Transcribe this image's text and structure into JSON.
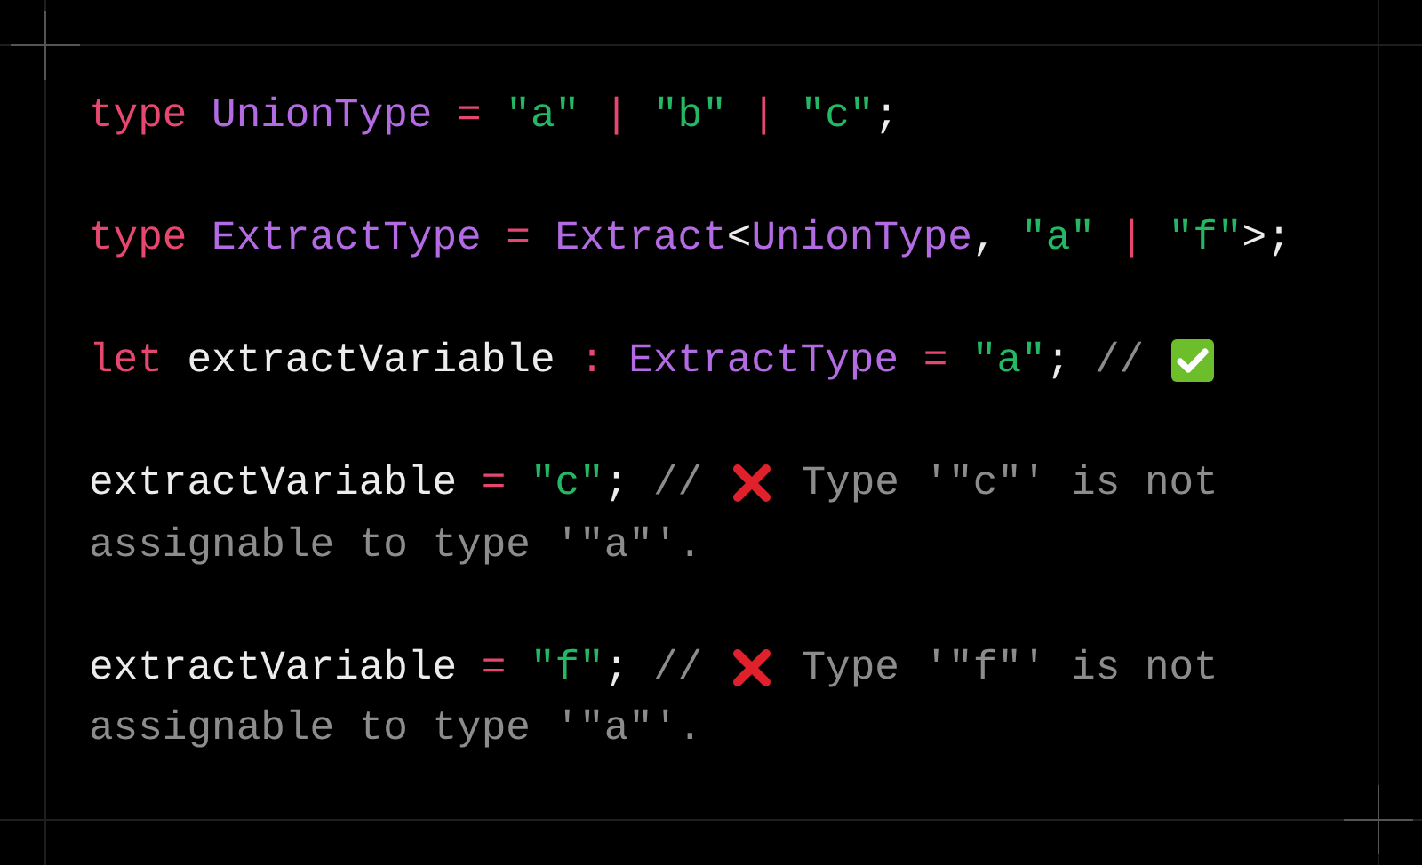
{
  "statements": [
    {
      "lines": [
        [
          {
            "kind": "keyword",
            "text": "type "
          },
          {
            "kind": "type",
            "text": "UnionType "
          },
          {
            "kind": "operator",
            "text": "= "
          },
          {
            "kind": "string",
            "text": "\"a\" "
          },
          {
            "kind": "operator",
            "text": "| "
          },
          {
            "kind": "string",
            "text": "\"b\" "
          },
          {
            "kind": "operator",
            "text": "| "
          },
          {
            "kind": "string",
            "text": "\"c\""
          },
          {
            "kind": "plain",
            "text": ";"
          }
        ]
      ]
    },
    {
      "lines": [
        [
          {
            "kind": "keyword",
            "text": "type "
          },
          {
            "kind": "type",
            "text": "ExtractType "
          },
          {
            "kind": "operator",
            "text": "= "
          },
          {
            "kind": "type",
            "text": "Extract"
          },
          {
            "kind": "plain",
            "text": "<"
          },
          {
            "kind": "type",
            "text": "UnionType"
          },
          {
            "kind": "plain",
            "text": ", "
          },
          {
            "kind": "string",
            "text": "\"a\" "
          },
          {
            "kind": "operator",
            "text": "| "
          },
          {
            "kind": "string",
            "text": "\"f\""
          },
          {
            "kind": "plain",
            "text": ">;"
          }
        ]
      ]
    },
    {
      "lines": [
        [
          {
            "kind": "keyword",
            "text": "let "
          },
          {
            "kind": "plain",
            "text": "extractVariable "
          },
          {
            "kind": "operator",
            "text": ": "
          },
          {
            "kind": "type",
            "text": "ExtractType "
          },
          {
            "kind": "operator",
            "text": "= "
          },
          {
            "kind": "string",
            "text": "\"a\""
          },
          {
            "kind": "plain",
            "text": "; "
          },
          {
            "kind": "comment",
            "text": "// "
          },
          {
            "kind": "checkmark"
          }
        ]
      ]
    },
    {
      "lines": [
        [
          {
            "kind": "plain",
            "text": "extractVariable "
          },
          {
            "kind": "operator",
            "text": "= "
          },
          {
            "kind": "string",
            "text": "\"c\""
          },
          {
            "kind": "plain",
            "text": "; "
          },
          {
            "kind": "comment",
            "text": "// "
          },
          {
            "kind": "crossmark"
          },
          {
            "kind": "comment",
            "text": " Type '\"c\"' is not"
          }
        ],
        [
          {
            "kind": "comment",
            "text": "assignable to type '\"a\"'."
          }
        ]
      ]
    },
    {
      "lines": [
        [
          {
            "kind": "plain",
            "text": "extractVariable "
          },
          {
            "kind": "operator",
            "text": "= "
          },
          {
            "kind": "string",
            "text": "\"f\""
          },
          {
            "kind": "plain",
            "text": "; "
          },
          {
            "kind": "comment",
            "text": "// "
          },
          {
            "kind": "crossmark"
          },
          {
            "kind": "comment",
            "text": " Type '\"f\"' is not"
          }
        ],
        [
          {
            "kind": "comment",
            "text": "assignable to type '\"a\"'."
          }
        ]
      ]
    }
  ]
}
